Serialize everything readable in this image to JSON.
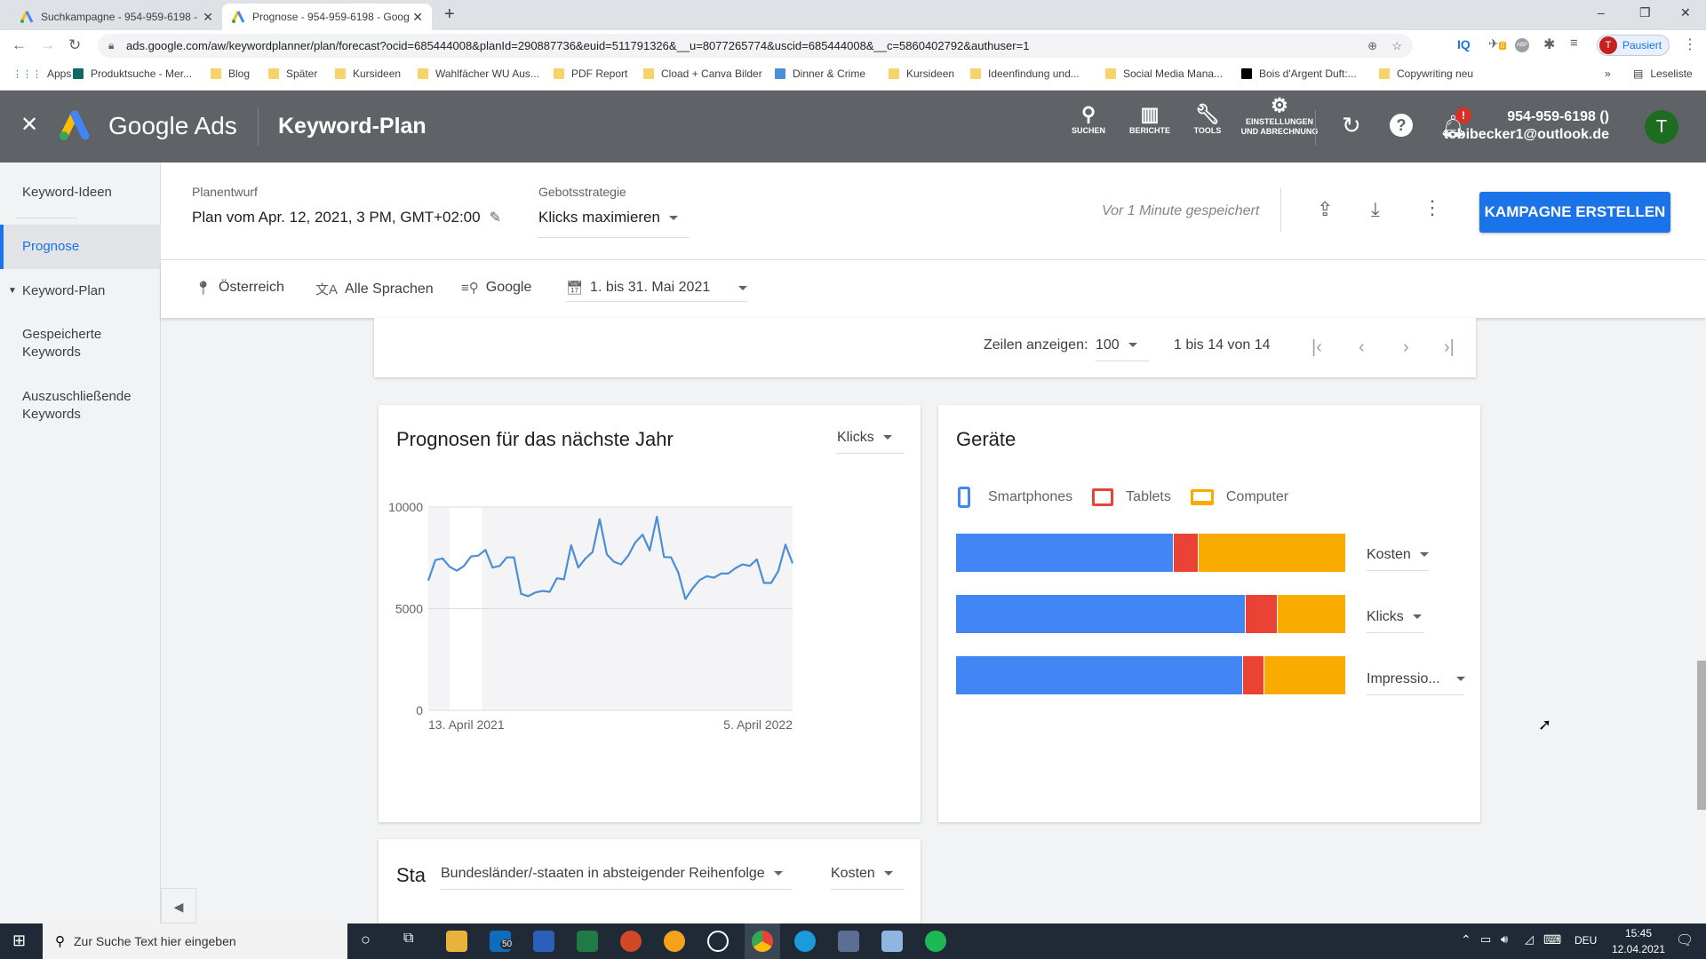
{
  "browser": {
    "tabs": [
      {
        "title": "Suchkampagne - 954-959-6198 -",
        "active": false
      },
      {
        "title": "Prognose - 954-959-6198 - Goog",
        "active": true
      }
    ],
    "new_tab": "+",
    "window_controls": {
      "minimize": "–",
      "maximize": "❐",
      "close": "✕"
    },
    "url": "ads.google.com/aw/keywordplanner/plan/forecast?ocid=685444008&planId=290887736&euid=511791326&__u=8077265774&uscid=685444008&__c=5860402792&authuser=1",
    "profile_initial": "T",
    "profile_status": "Pausiert",
    "extension_badge": "0",
    "bookmarks": [
      "Apps",
      "Produktsuche - Mer...",
      "Blog",
      "Später",
      "Kursideen",
      "Wahlfächer WU Aus...",
      "PDF Report",
      "Cload + Canva Bilder",
      "Dinner & Crime",
      "Kursideen",
      "Ideenfindung und...",
      "Social Media Mana...",
      "Bois d'Argent Duft:...",
      "Copywriting neu"
    ],
    "bookmarks_overflow": "»",
    "reading_list": "Leseliste"
  },
  "header": {
    "product": "Google Ads",
    "page_title": "Keyword-Plan",
    "nav": [
      {
        "label": "SUCHEN",
        "icon": "search-icon"
      },
      {
        "label": "BERICHTE",
        "icon": "reports-icon"
      },
      {
        "label": "TOOLS",
        "icon": "wrench-icon"
      },
      {
        "label": "EINSTELLUNGEN UND ABRECHNUNG",
        "icon": "gear-icon"
      }
    ],
    "notification_badge": "!",
    "account_id": "954-959-6198 ()",
    "account_email": "tobibecker1@outlook.de",
    "avatar_initial": "T"
  },
  "sidebar": {
    "items": [
      {
        "label": "Keyword-Ideen",
        "active": false
      },
      {
        "label": "Prognose",
        "active": true
      },
      {
        "label": "Keyword-Plan",
        "active": false,
        "expanded": true
      },
      {
        "label": "Gespeicherte Keywords",
        "active": false
      },
      {
        "label": "Auszuschließende Keywords",
        "active": false
      }
    ]
  },
  "plan": {
    "draft_label": "Planentwurf",
    "draft_value": "Plan vom Apr. 12, 2021, 3 PM, GMT+02:00",
    "bid_label": "Gebotsstrategie",
    "bid_value": "Klicks maximieren",
    "saved_status": "Vor 1 Minute gespeichert",
    "create_button": "KAMPAGNE ERSTELLEN"
  },
  "filters": {
    "location": "Österreich",
    "language": "Alle Sprachen",
    "network": "Google",
    "date_range": "1. bis 31. Mai 2021"
  },
  "pagination": {
    "rows_label": "Zeilen anzeigen:",
    "rows_value": "100",
    "range": "1 bis 14 von 14"
  },
  "forecast_card": {
    "title": "Prognosen für das nächste Jahr",
    "metric": "Klicks"
  },
  "devices_card": {
    "title": "Geräte",
    "legend": [
      {
        "label": "Smartphones",
        "color": "#4285f4"
      },
      {
        "label": "Tablets",
        "color": "#ea4335"
      },
      {
        "label": "Computer",
        "color": "#f9ab00"
      }
    ],
    "metrics": [
      "Kosten",
      "Klicks",
      "Impressio..."
    ]
  },
  "states_card": {
    "title_partial": "Sta",
    "sort": "Bundesländer/-staaten in absteigender Reihenfolge",
    "metric": "Kosten"
  },
  "taskbar": {
    "search_placeholder": "Zur Suche Text hier eingeben",
    "mail_badge": "50",
    "language": "DEU",
    "time": "15:45",
    "date": "12.04.2021"
  },
  "chart_data": [
    {
      "type": "line",
      "title": "Prognosen für das nächste Jahr",
      "xlabel": "",
      "ylabel": "Klicks",
      "x_tick_labels": [
        "13. April 2021",
        "5. April 2022"
      ],
      "y_ticks": [
        0,
        5000,
        10000
      ],
      "ylim": [
        0,
        10000
      ],
      "grid": true,
      "highlight_range_weeks": [
        3,
        7.5
      ],
      "series": [
        {
          "name": "Klicks",
          "color": "#4a8fd6",
          "values": [
            6380,
            7395,
            7470,
            7060,
            6870,
            7105,
            7570,
            7610,
            7890,
            7020,
            7105,
            7525,
            7525,
            5730,
            5615,
            5800,
            5875,
            5830,
            6500,
            6440,
            8120,
            7020,
            7470,
            7785,
            9405,
            7670,
            7310,
            7180,
            7610,
            8265,
            8640,
            7860,
            9520,
            7540,
            7525,
            6775,
            5470,
            6005,
            6410,
            6600,
            6525,
            6730,
            6730,
            6990,
            7180,
            7105,
            7425,
            6265,
            6265,
            6845,
            8150,
            7235
          ]
        }
      ]
    },
    {
      "type": "bar",
      "title": "Geräte",
      "stacked": true,
      "orientation": "horizontal",
      "unit": "percent share",
      "categories": [
        "Kosten",
        "Klicks",
        "Impressionen"
      ],
      "series": [
        {
          "name": "Smartphones",
          "color": "#4285f4",
          "values": [
            55.8,
            74.2,
            73.6
          ]
        },
        {
          "name": "Tablets",
          "color": "#ea4335",
          "values": [
            6.2,
            8.2,
            5.3
          ]
        },
        {
          "name": "Computer",
          "color": "#f9ab00",
          "values": [
            38.0,
            17.6,
            21.1
          ]
        }
      ],
      "legend": "top-left"
    }
  ]
}
